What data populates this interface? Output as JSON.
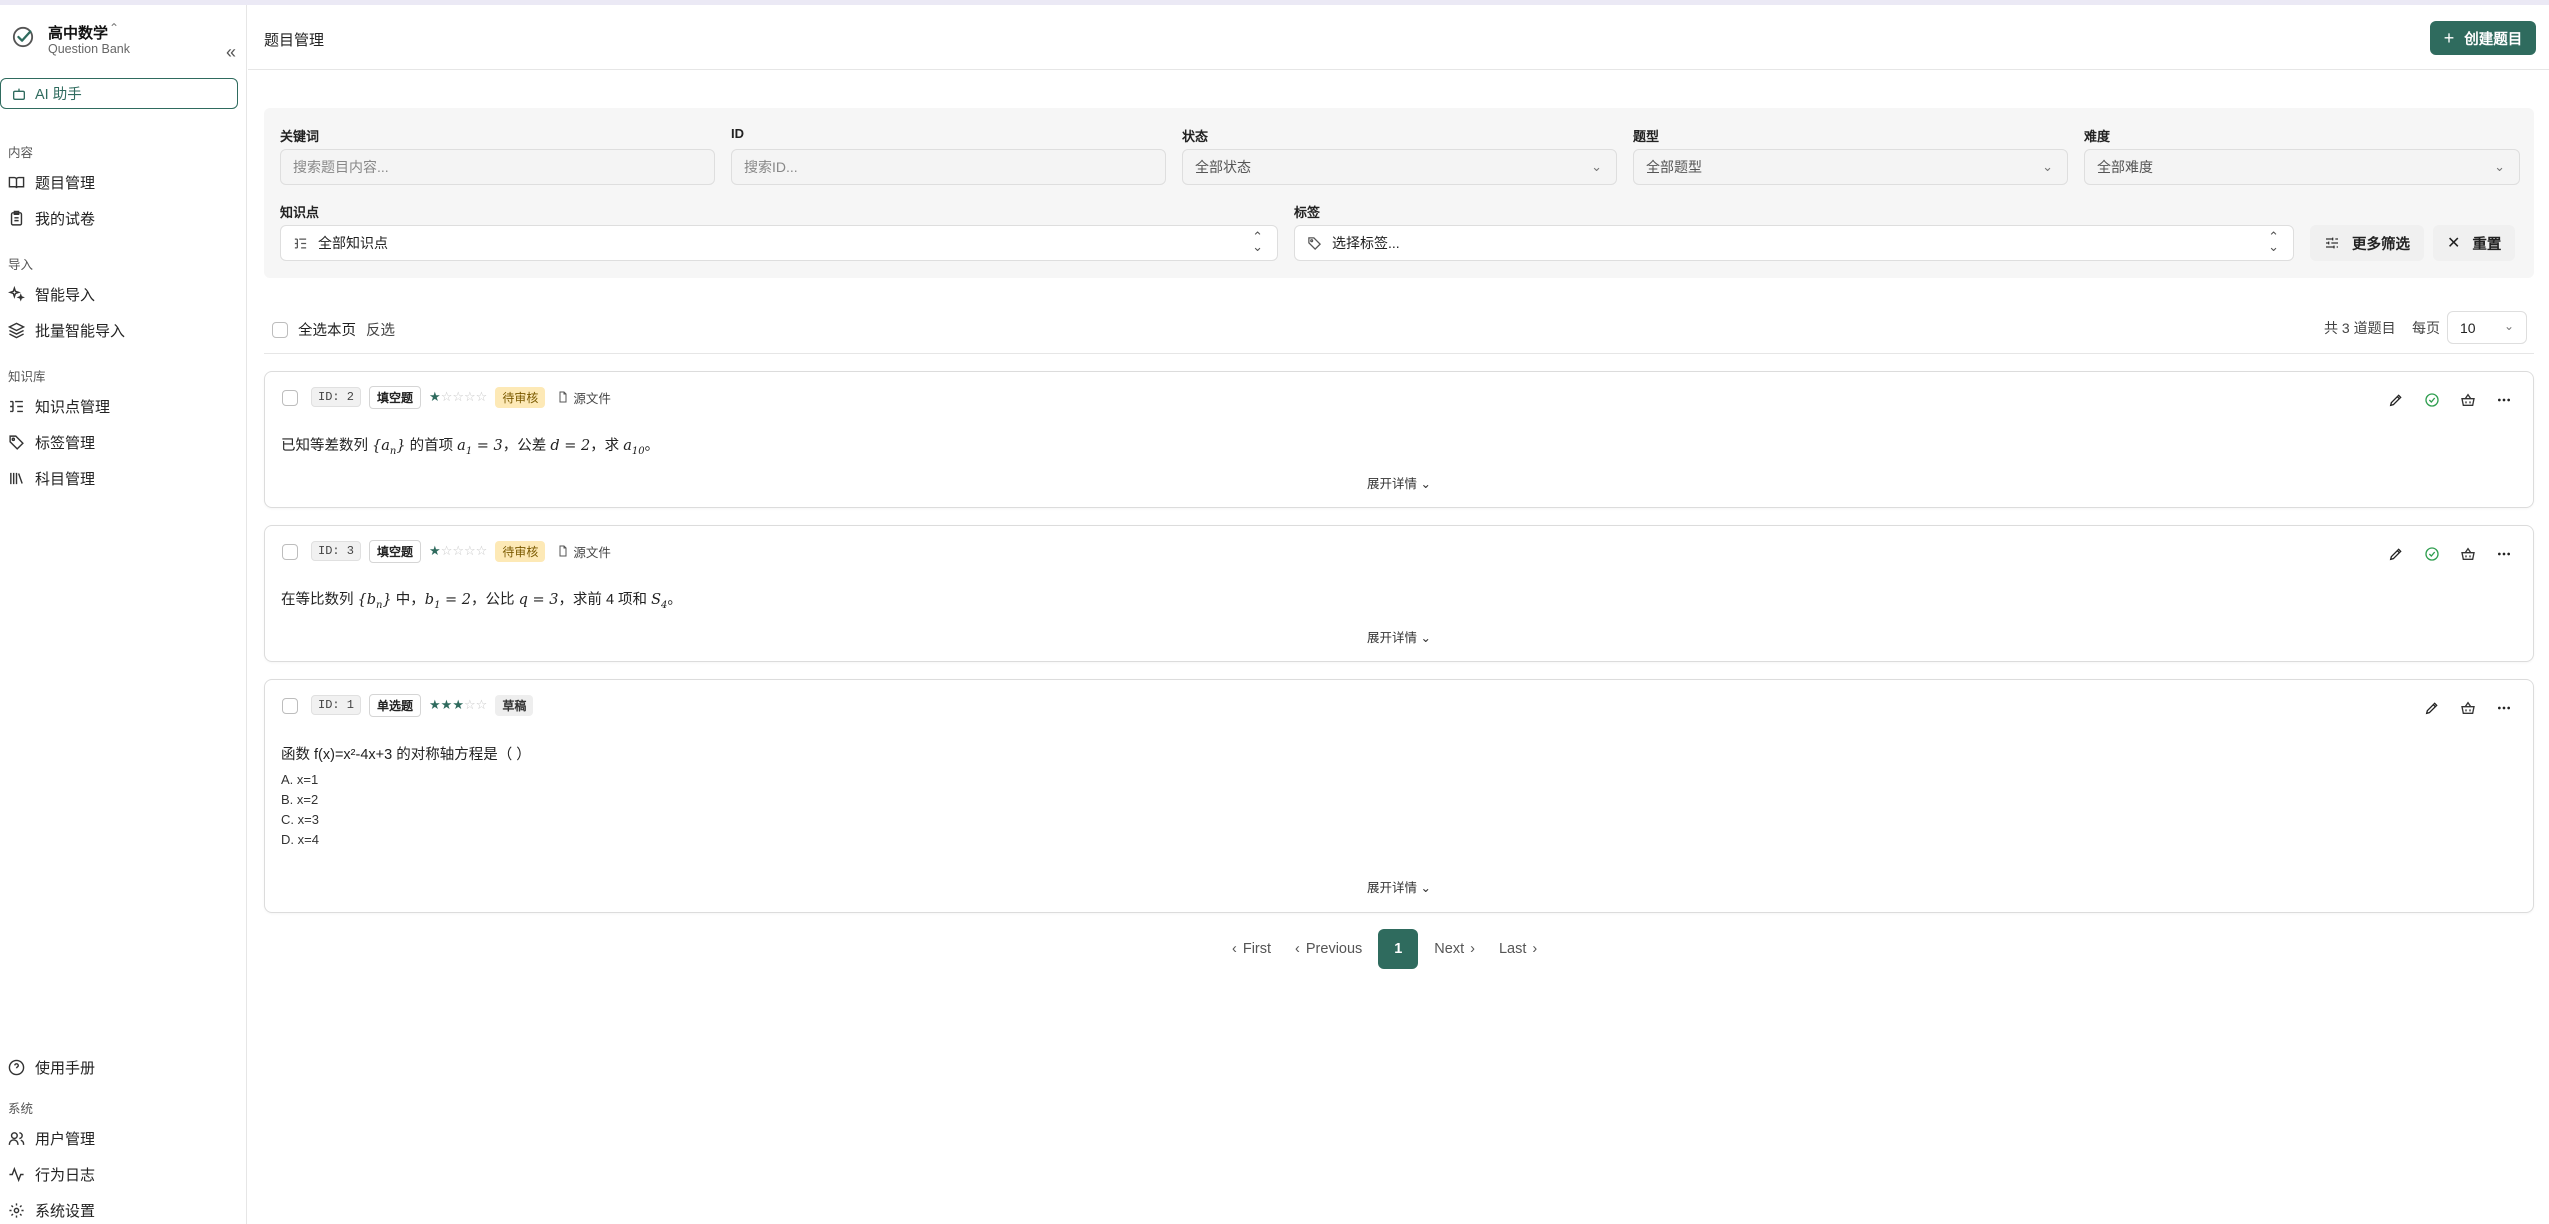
{
  "brand": {
    "title": "高中数学",
    "subtitle": "Question Bank"
  },
  "ai_button": "AI 助手",
  "sidebar": {
    "sections": [
      {
        "label": "内容",
        "items": [
          "题目管理",
          "我的试卷"
        ]
      },
      {
        "label": "导入",
        "items": [
          "智能导入",
          "批量智能导入"
        ]
      },
      {
        "label": "知识库",
        "items": [
          "知识点管理",
          "标签管理",
          "科目管理"
        ]
      }
    ],
    "bottom_item": "使用手册",
    "system_label": "系统",
    "system_items": [
      "用户管理",
      "行为日志",
      "系统设置"
    ]
  },
  "header": {
    "title": "题目管理",
    "create_label": "创建题目"
  },
  "filters": {
    "keyword": {
      "label": "关键词",
      "placeholder": "搜索题目内容..."
    },
    "id": {
      "label": "ID",
      "placeholder": "搜索ID..."
    },
    "status": {
      "label": "状态",
      "value": "全部状态"
    },
    "type": {
      "label": "题型",
      "value": "全部题型"
    },
    "difficulty": {
      "label": "难度",
      "value": "全部难度"
    },
    "knowledge": {
      "label": "知识点",
      "value": "全部知识点"
    },
    "tags": {
      "label": "标签",
      "value": "选择标签..."
    },
    "more_label": "更多筛选",
    "reset_label": "重置"
  },
  "list": {
    "select_all": "全选本页",
    "invert": "反选",
    "total": "共 3 道题目",
    "per_page_label": "每页",
    "per_page": "10"
  },
  "questions": [
    {
      "id_label": "ID: 2",
      "type": "填空题",
      "difficulty": 1,
      "status": "待审核",
      "source": "源文件",
      "text_prefix": "已知等差数列",
      "text_1": "的首项",
      "text_2": "，公差",
      "text_3": "，求",
      "text_end": "。",
      "expand": "展开详情"
    },
    {
      "id_label": "ID: 3",
      "type": "填空题",
      "difficulty": 1,
      "status": "待审核",
      "source": "源文件",
      "text_prefix": "在等比数列",
      "text_1": "中，",
      "text_2": "，公比",
      "text_3": "，求前 4 项和",
      "text_end": "。",
      "expand": "展开详情"
    },
    {
      "id_label": "ID: 1",
      "type": "单选题",
      "difficulty": 3,
      "status": "草稿",
      "text": "函数 f(x)=x²-4x+3 的对称轴方程是（ ）",
      "options": [
        "A.  x=1",
        "B.  x=2",
        "C.  x=3",
        "D.  x=4"
      ],
      "expand": "展开详情"
    }
  ],
  "pagination": {
    "first": "First",
    "previous": "Previous",
    "current": "1",
    "next": "Next",
    "last": "Last"
  },
  "colors": {
    "accent": "#2f6b5e",
    "pending_bg": "#fde9b6",
    "border": "#dcdcdc"
  }
}
